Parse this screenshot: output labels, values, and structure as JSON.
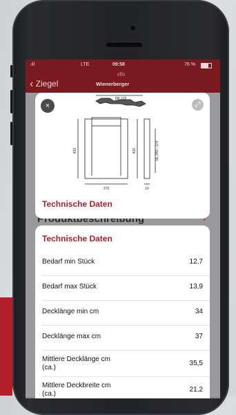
{
  "status": {
    "carrier": ".ıll",
    "network": "LTE",
    "time": "09:58",
    "battery": "76 %"
  },
  "nav": {
    "back_label": "Ziegel",
    "brand": "Wienerberger",
    "brand_mark": "ıllı"
  },
  "modal": {
    "close_icon": "×",
    "expand_icon": "⤢",
    "drawing": {
      "top_label": "DB 212",
      "width_label": "270",
      "height_label": "433",
      "side_height": "420",
      "side_width": "10",
      "side_range": "DL 340 - 370"
    },
    "title": "Technische Daten"
  },
  "underlay": {
    "title": "Produktbeschreibung",
    "plus": "+"
  },
  "sheet": {
    "title": "Technische Daten",
    "rows": [
      {
        "label": "Bedarf min Stück",
        "value": "12,7"
      },
      {
        "label": "Bedarf max Stück",
        "value": "13,9"
      },
      {
        "label": "Decklänge min cm",
        "value": "34"
      },
      {
        "label": "Decklänge max cm",
        "value": "37"
      },
      {
        "label": "Mittlere Decklänge cm (ca.)",
        "value": "35,5"
      },
      {
        "label": "Mittlere Deckbreite cm (ca.)",
        "value": "21,2"
      }
    ]
  }
}
